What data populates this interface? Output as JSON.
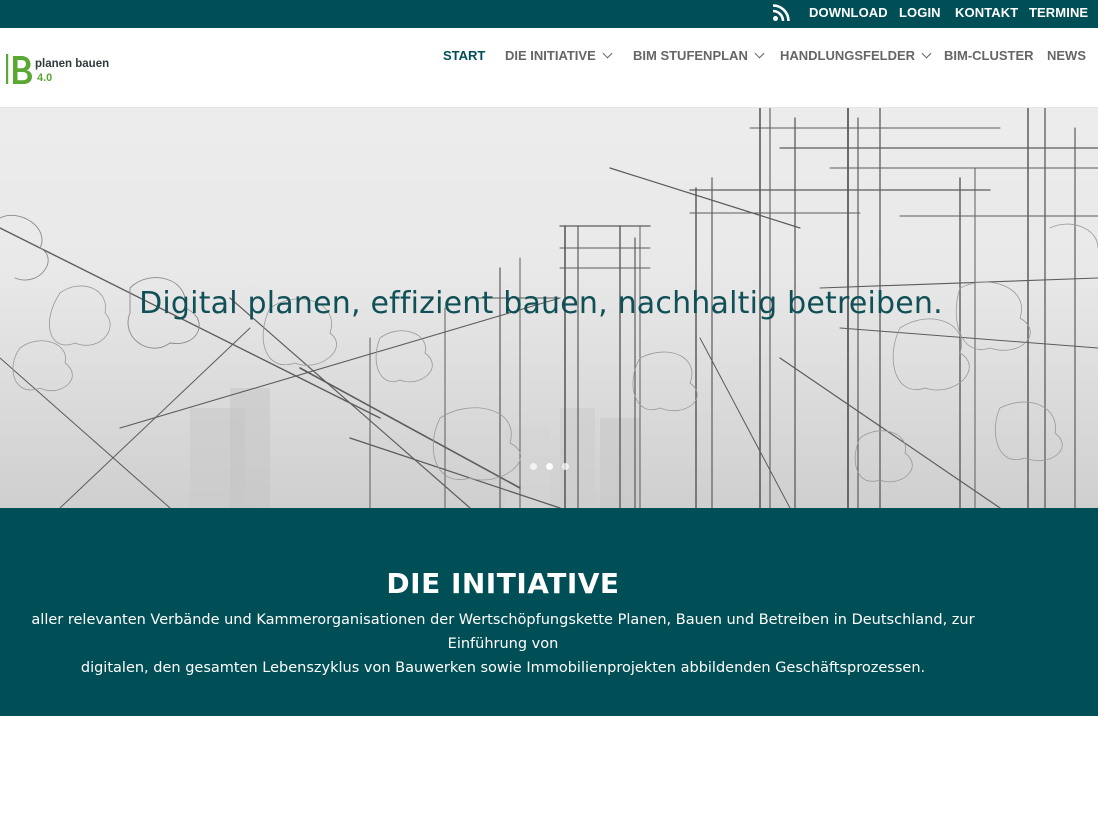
{
  "topbar": {
    "icons": [
      "rss-icon"
    ],
    "links": [
      "DOWNLOAD",
      "LOGIN",
      "KONTAKT",
      "TERMINE"
    ]
  },
  "logo": {
    "text": "planen bauen",
    "version": "4.0"
  },
  "nav": {
    "items": [
      {
        "label": "START",
        "active": true,
        "dropdown": false
      },
      {
        "label": "DIE INITIATIVE",
        "active": false,
        "dropdown": true
      },
      {
        "label": "BIM STUFENPLAN",
        "active": false,
        "dropdown": true
      },
      {
        "label": "HANDLUNGSFELDER",
        "active": false,
        "dropdown": true
      },
      {
        "label": "BIM-CLUSTER",
        "active": false,
        "dropdown": false
      },
      {
        "label": "NEWS",
        "active": false,
        "dropdown": false
      }
    ]
  },
  "hero": {
    "title": "Digital planen, effizient bauen, nachhaltig betreiben.",
    "slides": 3,
    "active_slide": 2
  },
  "initiative": {
    "title": "DIE INITIATIVE",
    "line1": "aller relevanten Verbände und Kammerorganisationen der Wertschöpfungskette Planen, Bauen und Betreiben in Deutschland, zur Einführung von",
    "line2": "digitalen, den gesamten Lebenszyklus von Bauwerken sowie Immobilienprojekten abbildenden Geschäftsprozessen."
  },
  "colors": {
    "brand_dark": "#004f56",
    "logo_green": "#5aa832",
    "nav_text": "#666666"
  }
}
